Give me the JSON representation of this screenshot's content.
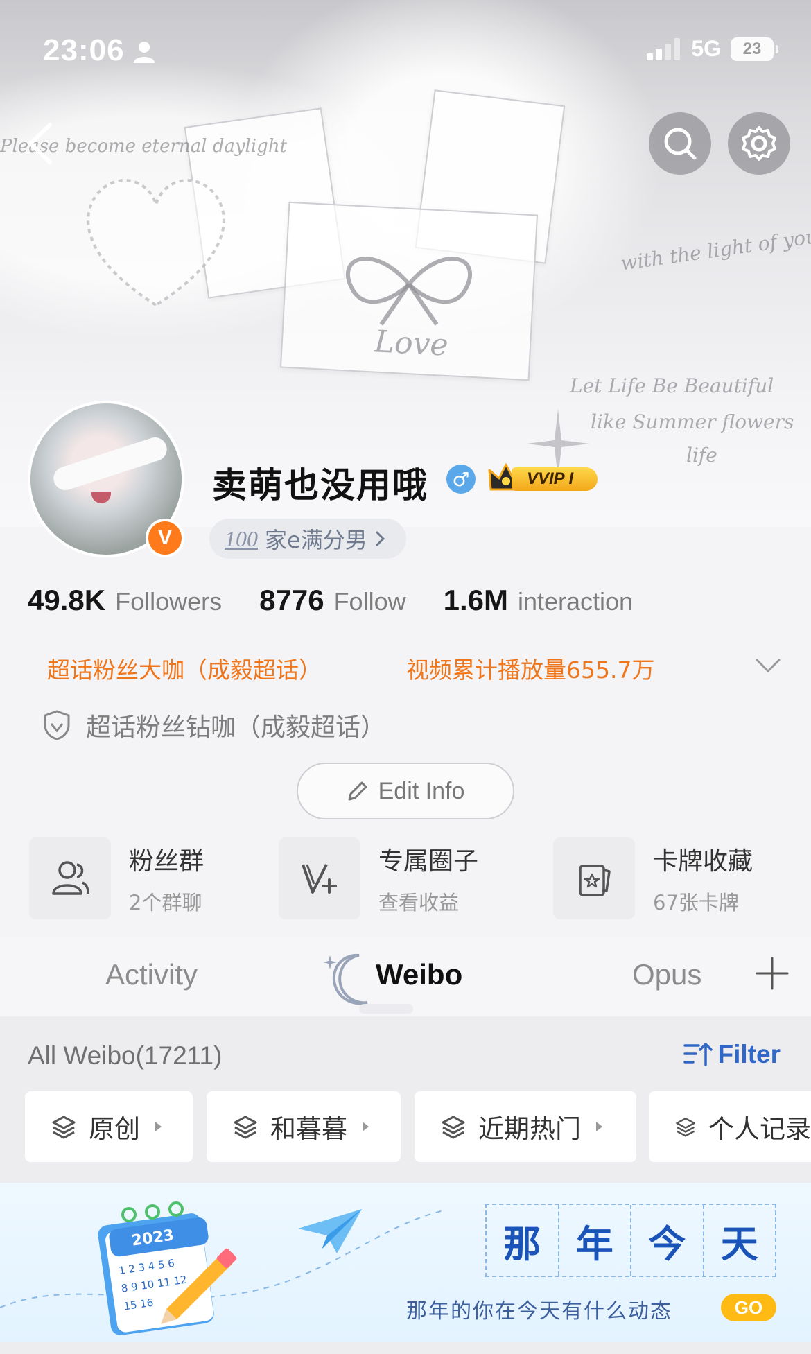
{
  "status_bar": {
    "time": "23:06",
    "network": "5G",
    "battery": "23"
  },
  "banner": {
    "deco_top_left": "Please become eternal daylight",
    "deco_middle": "Love",
    "deco_right": "with the light of your su",
    "deco_lines": [
      "Let Life Be Beautiful",
      "like Summer flowers",
      "life"
    ]
  },
  "profile": {
    "username": "卖萌也没用哦",
    "gender_symbol": "♂",
    "vip_label": "VVIP I",
    "verified_badge": "V",
    "tag_icon_text": "100",
    "tag_text": "家e满分男",
    "stats": [
      {
        "value": "49.8K",
        "label": "Followers"
      },
      {
        "value": "8776",
        "label": "Follow"
      },
      {
        "value": "1.6M",
        "label": "interaction"
      }
    ],
    "honors": [
      "超话粉丝大咖（成毅超话）",
      "视频累计播放量655.7万"
    ],
    "badge_text": "超话粉丝钻咖（成毅超话）",
    "edit_label": "Edit Info"
  },
  "features": [
    {
      "title": "粉丝群",
      "subtitle": "2个群聊",
      "icon": "users-icon"
    },
    {
      "title": "专属圈子",
      "subtitle": "查看收益",
      "icon": "v-plus-icon"
    },
    {
      "title": "卡牌收藏",
      "subtitle": "67张卡牌",
      "icon": "card-star-icon"
    }
  ],
  "tabs": {
    "items": [
      "Activity",
      "Weibo",
      "Opus"
    ],
    "active": "Weibo"
  },
  "feed": {
    "all_weibo": "All Weibo(17211)",
    "filter_label": "Filter",
    "chips": [
      "原创",
      "和暮暮",
      "近期热门",
      "个人记录"
    ]
  },
  "ad": {
    "calendar_year": "2023",
    "title_chars": [
      "那",
      "年",
      "今",
      "天"
    ],
    "caption": "那年的你在今天有什么动态",
    "go_label": "GO"
  },
  "colors": {
    "accent_orange": "#f0761c",
    "link_blue": "#3167c6",
    "vip_gold": "#f3a71b",
    "ad_blue": "#1b54b8"
  }
}
